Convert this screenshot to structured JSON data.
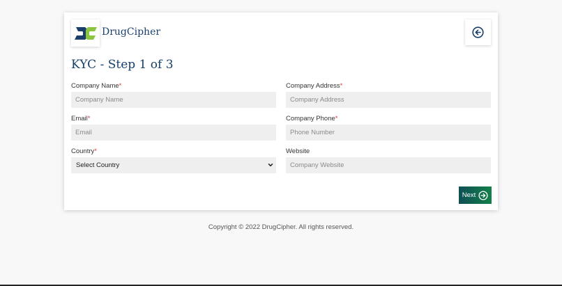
{
  "brand": {
    "name": "DrugCipher"
  },
  "page": {
    "title": "KYC - Step 1 of 3"
  },
  "form": {
    "company_name": {
      "label": "Company Name",
      "required_mark": "*",
      "placeholder": "Company Name",
      "value": ""
    },
    "company_address": {
      "label": "Company Address",
      "required_mark": "*",
      "placeholder": "Company Address",
      "value": ""
    },
    "email": {
      "label": "Email",
      "required_mark": "*",
      "placeholder": "Email",
      "value": ""
    },
    "company_phone": {
      "label": "Company Phone",
      "required_mark": "*",
      "placeholder": "Phone Number",
      "value": ""
    },
    "country": {
      "label": "Country",
      "required_mark": "*",
      "selected": "Select Country"
    },
    "website": {
      "label": "Website",
      "placeholder": "Company Website",
      "value": ""
    }
  },
  "actions": {
    "next_label": "Next"
  },
  "footer": {
    "copyright": "Copyright © 2022 DrugCipher. All rights reserved."
  },
  "icons": {
    "back": "arrow-left-circle-icon",
    "next": "arrow-right-circle-icon",
    "select": "chevron-down-icon"
  },
  "colors": {
    "primary": "#173f6a",
    "required": "#e0353b",
    "logo_green": "#8cc63f",
    "button_dark": "#0f4f55",
    "button_green": "#13804a"
  }
}
